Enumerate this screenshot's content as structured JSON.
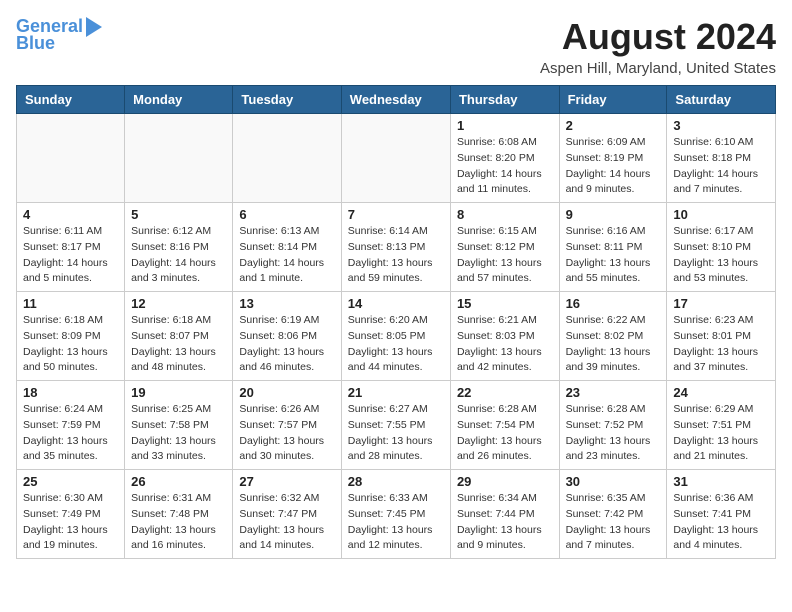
{
  "logo": {
    "text1": "General",
    "text2": "Blue"
  },
  "header": {
    "month_title": "August 2024",
    "location": "Aspen Hill, Maryland, United States"
  },
  "days_of_week": [
    "Sunday",
    "Monday",
    "Tuesday",
    "Wednesday",
    "Thursday",
    "Friday",
    "Saturday"
  ],
  "weeks": [
    [
      {
        "day": "",
        "info": ""
      },
      {
        "day": "",
        "info": ""
      },
      {
        "day": "",
        "info": ""
      },
      {
        "day": "",
        "info": ""
      },
      {
        "day": "1",
        "info": "Sunrise: 6:08 AM\nSunset: 8:20 PM\nDaylight: 14 hours and 11 minutes."
      },
      {
        "day": "2",
        "info": "Sunrise: 6:09 AM\nSunset: 8:19 PM\nDaylight: 14 hours and 9 minutes."
      },
      {
        "day": "3",
        "info": "Sunrise: 6:10 AM\nSunset: 8:18 PM\nDaylight: 14 hours and 7 minutes."
      }
    ],
    [
      {
        "day": "4",
        "info": "Sunrise: 6:11 AM\nSunset: 8:17 PM\nDaylight: 14 hours and 5 minutes."
      },
      {
        "day": "5",
        "info": "Sunrise: 6:12 AM\nSunset: 8:16 PM\nDaylight: 14 hours and 3 minutes."
      },
      {
        "day": "6",
        "info": "Sunrise: 6:13 AM\nSunset: 8:14 PM\nDaylight: 14 hours and 1 minute."
      },
      {
        "day": "7",
        "info": "Sunrise: 6:14 AM\nSunset: 8:13 PM\nDaylight: 13 hours and 59 minutes."
      },
      {
        "day": "8",
        "info": "Sunrise: 6:15 AM\nSunset: 8:12 PM\nDaylight: 13 hours and 57 minutes."
      },
      {
        "day": "9",
        "info": "Sunrise: 6:16 AM\nSunset: 8:11 PM\nDaylight: 13 hours and 55 minutes."
      },
      {
        "day": "10",
        "info": "Sunrise: 6:17 AM\nSunset: 8:10 PM\nDaylight: 13 hours and 53 minutes."
      }
    ],
    [
      {
        "day": "11",
        "info": "Sunrise: 6:18 AM\nSunset: 8:09 PM\nDaylight: 13 hours and 50 minutes."
      },
      {
        "day": "12",
        "info": "Sunrise: 6:18 AM\nSunset: 8:07 PM\nDaylight: 13 hours and 48 minutes."
      },
      {
        "day": "13",
        "info": "Sunrise: 6:19 AM\nSunset: 8:06 PM\nDaylight: 13 hours and 46 minutes."
      },
      {
        "day": "14",
        "info": "Sunrise: 6:20 AM\nSunset: 8:05 PM\nDaylight: 13 hours and 44 minutes."
      },
      {
        "day": "15",
        "info": "Sunrise: 6:21 AM\nSunset: 8:03 PM\nDaylight: 13 hours and 42 minutes."
      },
      {
        "day": "16",
        "info": "Sunrise: 6:22 AM\nSunset: 8:02 PM\nDaylight: 13 hours and 39 minutes."
      },
      {
        "day": "17",
        "info": "Sunrise: 6:23 AM\nSunset: 8:01 PM\nDaylight: 13 hours and 37 minutes."
      }
    ],
    [
      {
        "day": "18",
        "info": "Sunrise: 6:24 AM\nSunset: 7:59 PM\nDaylight: 13 hours and 35 minutes."
      },
      {
        "day": "19",
        "info": "Sunrise: 6:25 AM\nSunset: 7:58 PM\nDaylight: 13 hours and 33 minutes."
      },
      {
        "day": "20",
        "info": "Sunrise: 6:26 AM\nSunset: 7:57 PM\nDaylight: 13 hours and 30 minutes."
      },
      {
        "day": "21",
        "info": "Sunrise: 6:27 AM\nSunset: 7:55 PM\nDaylight: 13 hours and 28 minutes."
      },
      {
        "day": "22",
        "info": "Sunrise: 6:28 AM\nSunset: 7:54 PM\nDaylight: 13 hours and 26 minutes."
      },
      {
        "day": "23",
        "info": "Sunrise: 6:28 AM\nSunset: 7:52 PM\nDaylight: 13 hours and 23 minutes."
      },
      {
        "day": "24",
        "info": "Sunrise: 6:29 AM\nSunset: 7:51 PM\nDaylight: 13 hours and 21 minutes."
      }
    ],
    [
      {
        "day": "25",
        "info": "Sunrise: 6:30 AM\nSunset: 7:49 PM\nDaylight: 13 hours and 19 minutes."
      },
      {
        "day": "26",
        "info": "Sunrise: 6:31 AM\nSunset: 7:48 PM\nDaylight: 13 hours and 16 minutes."
      },
      {
        "day": "27",
        "info": "Sunrise: 6:32 AM\nSunset: 7:47 PM\nDaylight: 13 hours and 14 minutes."
      },
      {
        "day": "28",
        "info": "Sunrise: 6:33 AM\nSunset: 7:45 PM\nDaylight: 13 hours and 12 minutes."
      },
      {
        "day": "29",
        "info": "Sunrise: 6:34 AM\nSunset: 7:44 PM\nDaylight: 13 hours and 9 minutes."
      },
      {
        "day": "30",
        "info": "Sunrise: 6:35 AM\nSunset: 7:42 PM\nDaylight: 13 hours and 7 minutes."
      },
      {
        "day": "31",
        "info": "Sunrise: 6:36 AM\nSunset: 7:41 PM\nDaylight: 13 hours and 4 minutes."
      }
    ]
  ]
}
